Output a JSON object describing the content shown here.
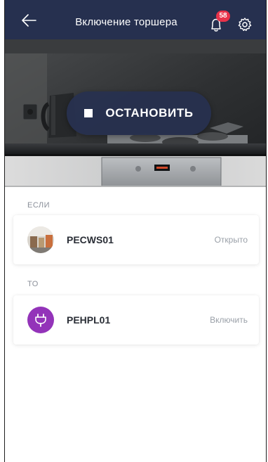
{
  "header": {
    "title": "Включение торшера",
    "notifications_count": "58",
    "icons": {
      "back": "arrow-left-icon",
      "bell": "bell-icon",
      "settings": "gear-icon"
    },
    "background": "#26304f"
  },
  "hero": {
    "stop_label": "ОСТАНОВИТЬ",
    "stop_icon": "stop-square-icon"
  },
  "if_section": {
    "label": "ЕСЛИ",
    "device": {
      "name": "PECWS01",
      "status": "Открыто",
      "icon": "camera-thumbnail"
    }
  },
  "then_section": {
    "label": "ТО",
    "device": {
      "name": "PEHPL01",
      "status": "Включить",
      "icon": "plug-icon",
      "icon_color": "#9333b9"
    }
  },
  "colors": {
    "accent": "#e8324a",
    "text": "#2a2e36",
    "muted": "#9aa0a8"
  }
}
